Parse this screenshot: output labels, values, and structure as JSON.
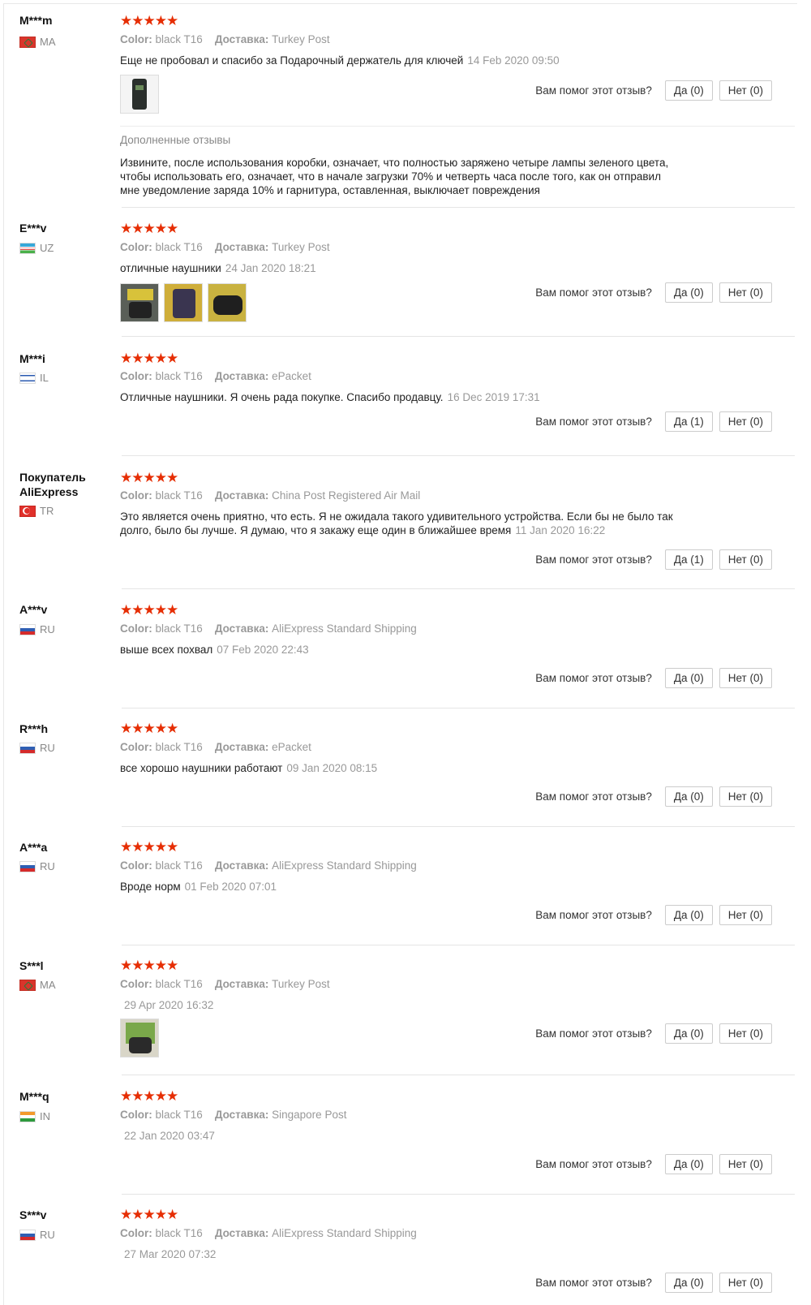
{
  "labels": {
    "color": "Color:",
    "delivery": "Доставка:",
    "helpful_q": "Вам помог этот отзыв?",
    "stars": "★★★★★",
    "additional_header": "Дополненные отзывы"
  },
  "reviews": [
    {
      "user": "M***m",
      "country": "MA",
      "color": "black T16",
      "delivery": "Turkey Post",
      "text": "Еще не пробовал и спасибо за Подарочный держатель для ключей",
      "date": "14 Feb 2020 09:50",
      "yes": "Да (0)",
      "no": "Нет (0)",
      "additional": "Извините, после использования коробки, означает, что полностью заряжено четыре лампы зеленого цвета, чтобы использовать его, означает, что в начале загрузки 70% и четверть часа после того, как он отправил мне уведомление заряда 10% и гарнитура, оставленная, выключает повреждения"
    },
    {
      "user": "E***v",
      "country": "UZ",
      "color": "black T16",
      "delivery": "Turkey Post",
      "text": "отличные наушники",
      "date": "24 Jan 2020 18:21",
      "yes": "Да (0)",
      "no": "Нет (0)"
    },
    {
      "user": "M***i",
      "country": "IL",
      "color": "black T16",
      "delivery": "ePacket",
      "text": "Отличные наушники. Я очень рада покупке. Спасибо продавцу.",
      "date": "16 Dec 2019 17:31",
      "yes": "Да (1)",
      "no": "Нет (0)"
    },
    {
      "user": "Покупатель AliExpress",
      "country": "TR",
      "color": "black T16",
      "delivery": "China Post Registered Air Mail",
      "text": "Это является очень приятно, что есть. Я не ожидала такого удивительного устройства. Если бы не было так долго, было бы лучше. Я думаю, что я закажу еще один в ближайшее время",
      "date": "11 Jan 2020 16:22",
      "yes": "Да (1)",
      "no": "Нет (0)"
    },
    {
      "user": "A***v",
      "country": "RU",
      "color": "black T16",
      "delivery": "AliExpress Standard Shipping",
      "text": "выше всех похвал",
      "date": "07 Feb 2020 22:43",
      "yes": "Да (0)",
      "no": "Нет (0)"
    },
    {
      "user": "R***h",
      "country": "RU",
      "color": "black T16",
      "delivery": "ePacket",
      "text": "все хорошо наушники работают",
      "date": "09 Jan 2020 08:15",
      "yes": "Да (0)",
      "no": "Нет (0)"
    },
    {
      "user": "A***a",
      "country": "RU",
      "color": "black T16",
      "delivery": "AliExpress Standard Shipping",
      "text": "Вроде норм",
      "date": "01 Feb 2020 07:01",
      "yes": "Да (0)",
      "no": "Нет (0)"
    },
    {
      "user": "S***l",
      "country": "MA",
      "color": "black T16",
      "delivery": "Turkey Post",
      "text": "",
      "date": "29 Apr 2020 16:32",
      "yes": "Да (0)",
      "no": "Нет (0)"
    },
    {
      "user": "M***q",
      "country": "IN",
      "color": "black T16",
      "delivery": "Singapore Post",
      "text": "",
      "date": "22 Jan 2020 03:47",
      "yes": "Да (0)",
      "no": "Нет (0)"
    },
    {
      "user": "S***v",
      "country": "RU",
      "color": "black T16",
      "delivery": "AliExpress Standard Shipping",
      "text": "",
      "date": "27 Mar 2020 07:32",
      "yes": "Да (0)",
      "no": "Нет (0)"
    }
  ]
}
